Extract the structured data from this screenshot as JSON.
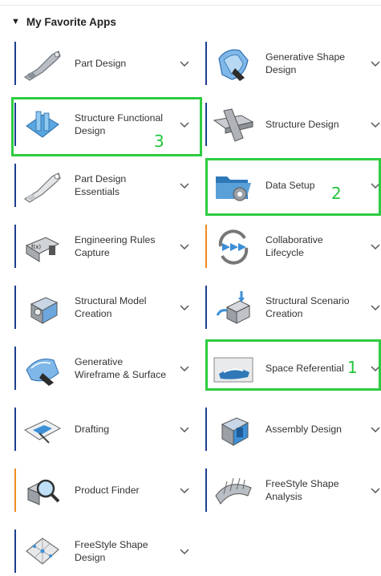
{
  "section": {
    "title": "My Favorite Apps",
    "toggle_glyph": "▼"
  },
  "apps": [
    {
      "label": "Part Design",
      "icon": "part-design-icon",
      "bar": "#1d3f8f"
    },
    {
      "label": "Generative Shape Design",
      "icon": "generative-shape-icon",
      "bar": "#1d3f8f"
    },
    {
      "label": "Structure Functional Design",
      "icon": "structure-functional-icon",
      "bar": "#1d3f8f"
    },
    {
      "label": "Structure Design",
      "icon": "structure-design-icon",
      "bar": "#1d3f8f"
    },
    {
      "label": "Part Design Essentials",
      "icon": "part-design-essentials-icon",
      "bar": "#1d3f8f"
    },
    {
      "label": "Data Setup",
      "icon": "data-setup-icon",
      "bar": "#1d3f8f"
    },
    {
      "label": "Engineering Rules Capture",
      "icon": "engineering-rules-icon",
      "bar": "#1d3f8f"
    },
    {
      "label": "Collaborative Lifecycle",
      "icon": "collaborative-lifecycle-icon",
      "bar": "#f08b1f"
    },
    {
      "label": "Structural Model Creation",
      "icon": "structural-model-icon",
      "bar": "#1d3f8f"
    },
    {
      "label": "Structural Scenario Creation",
      "icon": "structural-scenario-icon",
      "bar": "#1d3f8f"
    },
    {
      "label": "Generative Wireframe & Surface",
      "icon": "generative-wireframe-icon",
      "bar": "#1d3f8f"
    },
    {
      "label": "Space Referential",
      "icon": "space-referential-icon",
      "bar": "#1d3f8f"
    },
    {
      "label": "Drafting",
      "icon": "drafting-icon",
      "bar": "#1d3f8f"
    },
    {
      "label": "Assembly Design",
      "icon": "assembly-design-icon",
      "bar": "#1d3f8f"
    },
    {
      "label": "Product Finder",
      "icon": "product-finder-icon",
      "bar": "#f08b1f"
    },
    {
      "label": "FreeStyle Shape Analysis",
      "icon": "freestyle-analysis-icon",
      "bar": "#1d3f8f"
    },
    {
      "label": "FreeStyle Shape Design",
      "icon": "freestyle-design-icon",
      "bar": "#1d3f8f"
    }
  ],
  "highlights": [
    {
      "number": "1",
      "target": "Space Referential"
    },
    {
      "number": "2",
      "target": "Data Setup"
    },
    {
      "number": "3",
      "target": "Structure Functional Design"
    }
  ],
  "colors": {
    "accent_bar": "#1d3f8f",
    "orange_bar": "#f08b1f",
    "highlight": "#2ecc40"
  }
}
